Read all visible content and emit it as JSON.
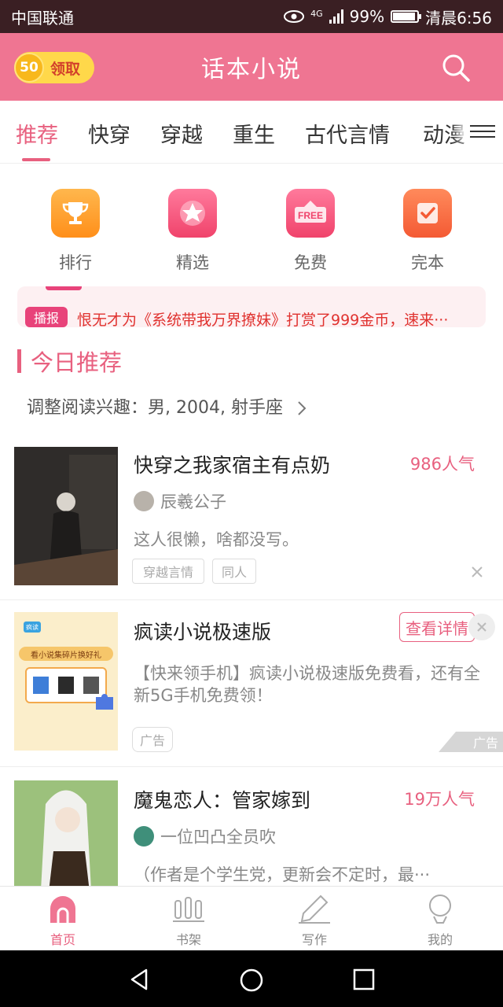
{
  "status_bar": {
    "carrier": "中国联通",
    "network": "4G",
    "battery": "99%",
    "time": "清晨6:56"
  },
  "header": {
    "title": "话本小说",
    "coin_amount": "50",
    "claim_label": "领取"
  },
  "tabs": [
    {
      "label": "推荐",
      "active": true
    },
    {
      "label": "快穿"
    },
    {
      "label": "穿越"
    },
    {
      "label": "重生"
    },
    {
      "label": "古代言情"
    },
    {
      "label": "动漫"
    }
  ],
  "quick_links": [
    {
      "label": "排行",
      "icon": "trophy-icon"
    },
    {
      "label": "精选",
      "icon": "star-icon"
    },
    {
      "label": "免费",
      "icon": "free-icon",
      "icon_text": "FREE"
    },
    {
      "label": "完本",
      "icon": "check-icon"
    }
  ],
  "broadcast": {
    "badge": "播报",
    "message": "恨无才为《系统带我万界撩妹》打赏了999金币，速来···"
  },
  "section": {
    "title": "今日推荐",
    "preference": "调整阅读兴趣：男, 2004, 射手座"
  },
  "books": [
    {
      "title": "快穿之我家宿主有点奶",
      "popularity": "986人气",
      "author": "辰羲公子",
      "desc": "这人很懒，啥都没写。",
      "tags": [
        "穿越言情",
        "同人"
      ]
    },
    {
      "title": "魔鬼恋人：管家嫁到",
      "popularity": "19万人气",
      "author": "一位凹凸全员吹",
      "desc": "（作者是个学生党，更新会不定时，最···"
    }
  ],
  "ad": {
    "title": "疯读小说极速版",
    "button": "查看详情",
    "desc": "【快来领手机】疯读小说极速版免费看，还有全新5G手机免费领！",
    "tag": "广告",
    "corner": "广告",
    "cover_logo": "疯读",
    "cover_text": "看小说集碎片换好礼"
  },
  "bottom_nav": [
    {
      "label": "首页",
      "active": true
    },
    {
      "label": "书架"
    },
    {
      "label": "写作"
    },
    {
      "label": "我的"
    }
  ],
  "colors": {
    "primary": "#ef7592",
    "accent": "#e8607f",
    "status_bar": "#3a1f23"
  }
}
